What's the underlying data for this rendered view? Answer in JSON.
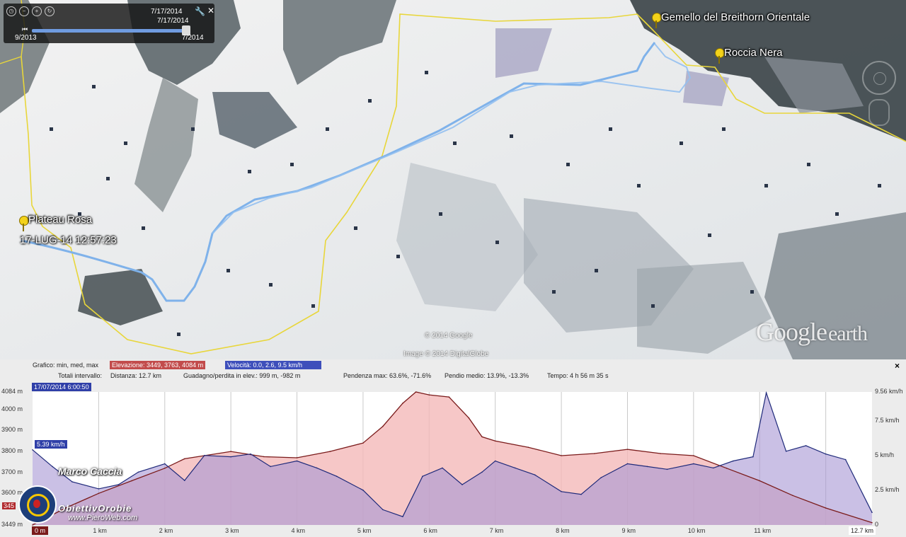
{
  "map": {
    "labels": {
      "gemello": "Gemello del Breithorn Orientale",
      "roccia": "Roccia Nera",
      "plateau": "Plateau Rosa",
      "timestamp": "17-LUG-14 12:57:23"
    },
    "attribution_1": "© 2014 Google",
    "attribution_2": "Image © 2014 DigitalGlobe",
    "logo_main": "Google",
    "logo_sub": "earth",
    "track_color": "#7fb2ea",
    "boundary_color": "#e8d63a"
  },
  "time_slider": {
    "date_top": "7/17/2014",
    "date_current": "7/17/2014",
    "range_start": "9/2013",
    "range_end": "7/2014"
  },
  "profile": {
    "stats": {
      "chart_label": "Grafico: min, med, max",
      "elevation": "Elevazione: 3449, 3763, 4084 m",
      "speed": "Velocità: 0.0, 2.6, 9.5 km/h",
      "totals_label": "Totali intervallo:",
      "distance": "Distanza: 12.7 km",
      "gain_loss": "Guadagno/perdita in elev.: 999 m, -982 m",
      "max_slope": "Pendenza max: 63.6%, -71.6%",
      "avg_slope": "Pendio medio: 13.9%, -13.3%",
      "time": "Tempo: 4 h 56 m 35 s"
    },
    "cursor_date": "17/07/2014 6:00:50",
    "cursor_speed": "5.39 km/h",
    "cursor_elev": "345",
    "watermark_author": "Marco Caccia",
    "watermark_site": "ObiettivOrobie",
    "watermark_url": "www.PieroWeb.com",
    "close_label": "×",
    "colors": {
      "elevation": "#7a1b1b",
      "elevation_fill": "#f4b9b9",
      "speed": "#1f2a7a",
      "speed_fill": "#a796d4"
    }
  },
  "chart_data": {
    "type": "area",
    "x_unit": "km",
    "x_range": [
      0,
      12.7
    ],
    "x_ticks": [
      "0 m",
      "1 km",
      "2 km",
      "3 km",
      "4 km",
      "5 km",
      "6 km",
      "7 km",
      "8 km",
      "9 km",
      "10 km",
      "11 km",
      "12.7 km"
    ],
    "y_left_ticks": [
      "4084 m",
      "4000 m",
      "3900 m",
      "3800 m",
      "3700 m",
      "3600 m",
      "3449 m"
    ],
    "y_left_range": [
      3449,
      4084
    ],
    "y_right_ticks": [
      "9.56 km/h",
      "7.5 km/h",
      "5 km/h",
      "2.5 km/h",
      "0"
    ],
    "y_right_range": [
      0,
      9.56
    ],
    "series": [
      {
        "name": "Elevazione",
        "x": [
          0,
          0.5,
          1,
          1.5,
          2,
          2.3,
          2.6,
          3,
          3.5,
          4,
          4.5,
          5,
          5.3,
          5.6,
          5.8,
          6,
          6.3,
          6.6,
          6.8,
          7,
          7.5,
          8,
          8.5,
          9,
          9.5,
          10,
          10.5,
          11,
          11.5,
          12,
          12.7
        ],
        "values": [
          3449,
          3530,
          3600,
          3660,
          3720,
          3765,
          3780,
          3800,
          3775,
          3770,
          3800,
          3840,
          3920,
          4030,
          4084,
          4070,
          4060,
          3960,
          3870,
          3850,
          3820,
          3780,
          3790,
          3810,
          3790,
          3780,
          3720,
          3660,
          3590,
          3530,
          3460
        ]
      },
      {
        "name": "Velocità",
        "x": [
          0,
          0.3,
          0.6,
          1,
          1.3,
          1.6,
          2,
          2.3,
          2.6,
          3,
          3.3,
          3.6,
          4,
          4.3,
          4.6,
          5,
          5.3,
          5.6,
          5.9,
          6.2,
          6.5,
          6.8,
          7,
          7.3,
          7.6,
          8,
          8.3,
          8.6,
          9,
          9.3,
          9.6,
          10,
          10.3,
          10.6,
          10.9,
          11.1,
          11.4,
          11.7,
          12,
          12.3,
          12.7
        ],
        "values": [
          5.4,
          4.2,
          3.1,
          2.6,
          2.9,
          3.8,
          4.4,
          3.2,
          5.0,
          4.9,
          5.1,
          4.2,
          4.6,
          4.1,
          3.5,
          2.5,
          1.1,
          0.6,
          3.5,
          4.1,
          2.9,
          3.8,
          4.6,
          4.1,
          3.6,
          2.4,
          2.2,
          3.4,
          4.4,
          4.2,
          4.0,
          4.4,
          4.1,
          4.6,
          4.9,
          9.5,
          5.3,
          5.7,
          5.1,
          4.7,
          0.9
        ]
      }
    ],
    "legend": "none",
    "grid": true
  }
}
